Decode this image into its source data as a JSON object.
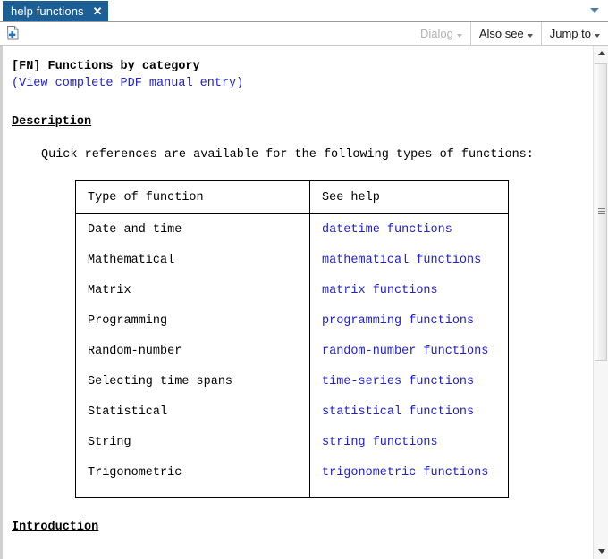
{
  "window": {
    "tab": {
      "label": "help functions",
      "close_icon": "close-icon"
    },
    "tablist_dropdown_icon": "chevron-down-icon"
  },
  "toolbar": {
    "new_icon": "new-document-icon",
    "buttons": [
      {
        "label": "Dialog",
        "disabled": true,
        "caret_icon": "chevron-down-icon"
      },
      {
        "label": "Also see",
        "disabled": false,
        "caret_icon": "chevron-down-icon"
      },
      {
        "label": "Jump to",
        "disabled": false,
        "caret_icon": "chevron-down-icon"
      }
    ]
  },
  "document": {
    "title": "[FN] Functions by category",
    "pdf_open_paren": "(",
    "pdf_link": "View complete PDF manual entry",
    "pdf_close_paren": ")",
    "description_heading": "Description",
    "description_text": "Quick references are available for the following types of functions:",
    "table": {
      "headers": [
        "Type of function",
        "See help"
      ],
      "rows": [
        {
          "type": "Date and time",
          "help": "datetime functions"
        },
        {
          "type": "Mathematical",
          "help": "mathematical functions"
        },
        {
          "type": "Matrix",
          "help": "matrix functions"
        },
        {
          "type": "Programming",
          "help": "programming functions"
        },
        {
          "type": "Random-number",
          "help": "random-number functions"
        },
        {
          "type": "Selecting time spans",
          "help": "time-series functions"
        },
        {
          "type": "Statistical",
          "help": "statistical functions"
        },
        {
          "type": "String",
          "help": "string functions"
        },
        {
          "type": "Trigonometric",
          "help": "trigonometric functions"
        }
      ]
    },
    "introduction_heading": "Introduction"
  },
  "scrollbar": {
    "up_icon": "scroll-up-arrow-icon",
    "down_icon": "scroll-down-arrow-icon"
  },
  "colors": {
    "tab_active_bg": "#1c5f96",
    "link": "#2020cc",
    "text": "#000000",
    "disabled_text": "#b4b4b4"
  }
}
